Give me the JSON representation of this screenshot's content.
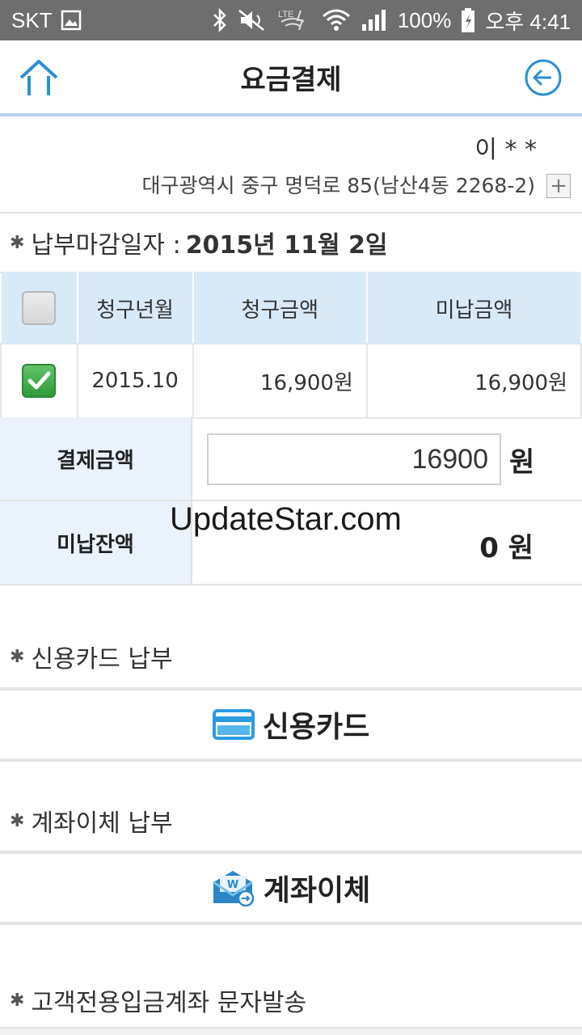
{
  "status_bar": {
    "carrier": "SKT",
    "battery": "100%",
    "time": "오후 4:41"
  },
  "header": {
    "title": "요금결제",
    "icons": {
      "home": "home-arrow-icon",
      "back": "back-circle-icon"
    }
  },
  "user": {
    "name": "이 * *",
    "address": "대구광역시 중구 명덕로 85(남산4동 2268-2)",
    "expand_label": "+"
  },
  "due": {
    "label": "납부마감일자 :",
    "date": "2015년 11월 2일"
  },
  "table": {
    "headers": [
      "청구년월",
      "청구금액",
      "미납금액"
    ],
    "rows": [
      {
        "checked": true,
        "month": "2015.10",
        "billed": "16,900원",
        "unpaid": "16,900원"
      }
    ]
  },
  "payment": {
    "amount_label": "결제금액",
    "amount_value": "16900",
    "unit": "원",
    "balance_label": "미납잔액",
    "balance_value": "0 원"
  },
  "watermark": "UpdateStar.com",
  "sections": {
    "card": {
      "heading": "신용카드 납부",
      "button": "신용카드",
      "icon": "credit-card-icon"
    },
    "transfer": {
      "heading": "계좌이체 납부",
      "button": "계좌이체",
      "icon": "envelope-transfer-icon"
    },
    "sms": {
      "heading": "고객전용입금계좌 문자발송"
    }
  },
  "colors": {
    "accent": "#2b8fd0",
    "header_border": "#b8d3ea",
    "table_head_bg": "#d8e9f8",
    "label_bg": "#eaf3fc",
    "checkbox_green": "#2e9a39"
  }
}
